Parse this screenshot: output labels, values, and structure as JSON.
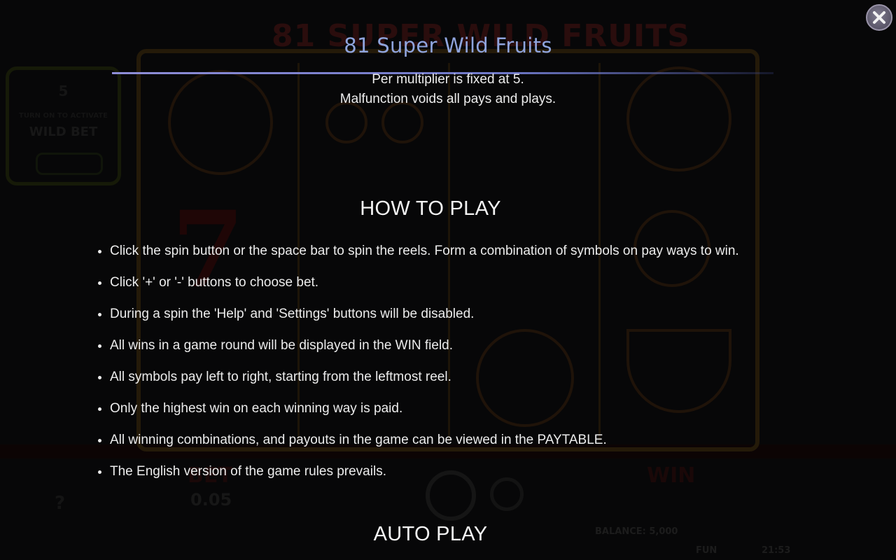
{
  "background": {
    "game_title": "81 SUPER WILD FRUITS",
    "wild_box": {
      "number": "5",
      "caption": "TURN ON TO ACTIVATE",
      "label": "WILD BET"
    },
    "bet_label": "BET",
    "bet_value": "0.05",
    "win_label": "WIN",
    "balance": "BALANCE: 5,000",
    "mode": "FUN",
    "clock": "21:53"
  },
  "help": {
    "title": "81 Super Wild Fruits",
    "top_lines": [
      "Per multiplier is fixed at 5.",
      "Malfunction voids all pays and plays."
    ],
    "how_to_play": {
      "heading": "HOW TO PLAY",
      "items": [
        "Click the spin button or the space bar to spin the reels. Form a combination of symbols on pay ways to win.",
        "Click '+' or '-' buttons to choose bet.",
        "During a spin the 'Help' and 'Settings' buttons will be disabled.",
        "All wins in a game round will be displayed in the WIN field.",
        "All symbols pay left to right, starting from the leftmost reel.",
        "Only the highest win on each winning way is paid.",
        "All winning combinations, and payouts in the game can be viewed in the PAYTABLE.",
        "The English version of the game rules prevails."
      ]
    },
    "auto_play": {
      "heading": "AUTO PLAY"
    },
    "close_icon": "close-x-icon"
  },
  "colors": {
    "title": "#8fa4dd",
    "text": "#ececec",
    "divider": "#8f8ed8",
    "close_button": "#6b6779"
  }
}
